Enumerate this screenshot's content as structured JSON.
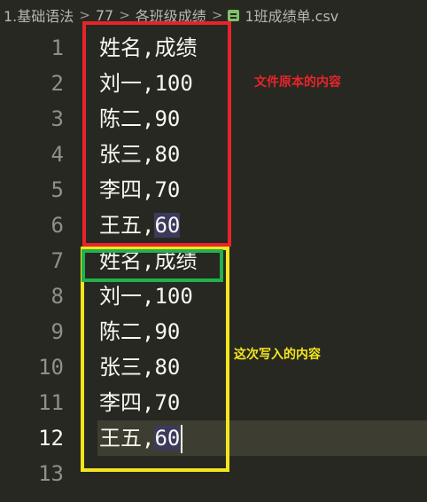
{
  "breadcrumb": {
    "items": [
      "1.基础语法",
      "77",
      "各班级成绩"
    ],
    "file": "1班成绩单.csv",
    "separator": ">"
  },
  "editor": {
    "lines": [
      {
        "number": "1",
        "text": "姓名,成绩"
      },
      {
        "number": "2",
        "text": "刘一,100"
      },
      {
        "number": "3",
        "text": "陈二,90"
      },
      {
        "number": "4",
        "text": "张三,80"
      },
      {
        "number": "5",
        "text": "李四,70"
      },
      {
        "number": "6",
        "text_a": "王五,",
        "text_b": "60"
      },
      {
        "number": "7",
        "text": "姓名,成绩"
      },
      {
        "number": "8",
        "text": "刘一,100"
      },
      {
        "number": "9",
        "text": "陈二,90"
      },
      {
        "number": "10",
        "text": "张三,80"
      },
      {
        "number": "11",
        "text": "李四,70"
      },
      {
        "number": "12",
        "text_a": "王五,",
        "text_b": "60"
      },
      {
        "number": "13",
        "text": ""
      }
    ],
    "current_line": "12"
  },
  "annotations": {
    "original": "文件原本的内容",
    "written": "这次写入的内容"
  },
  "colors": {
    "background": "#272822",
    "red_box": "#e8242a",
    "yellow_box": "#f4e61c",
    "green_box": "#22b14c"
  }
}
